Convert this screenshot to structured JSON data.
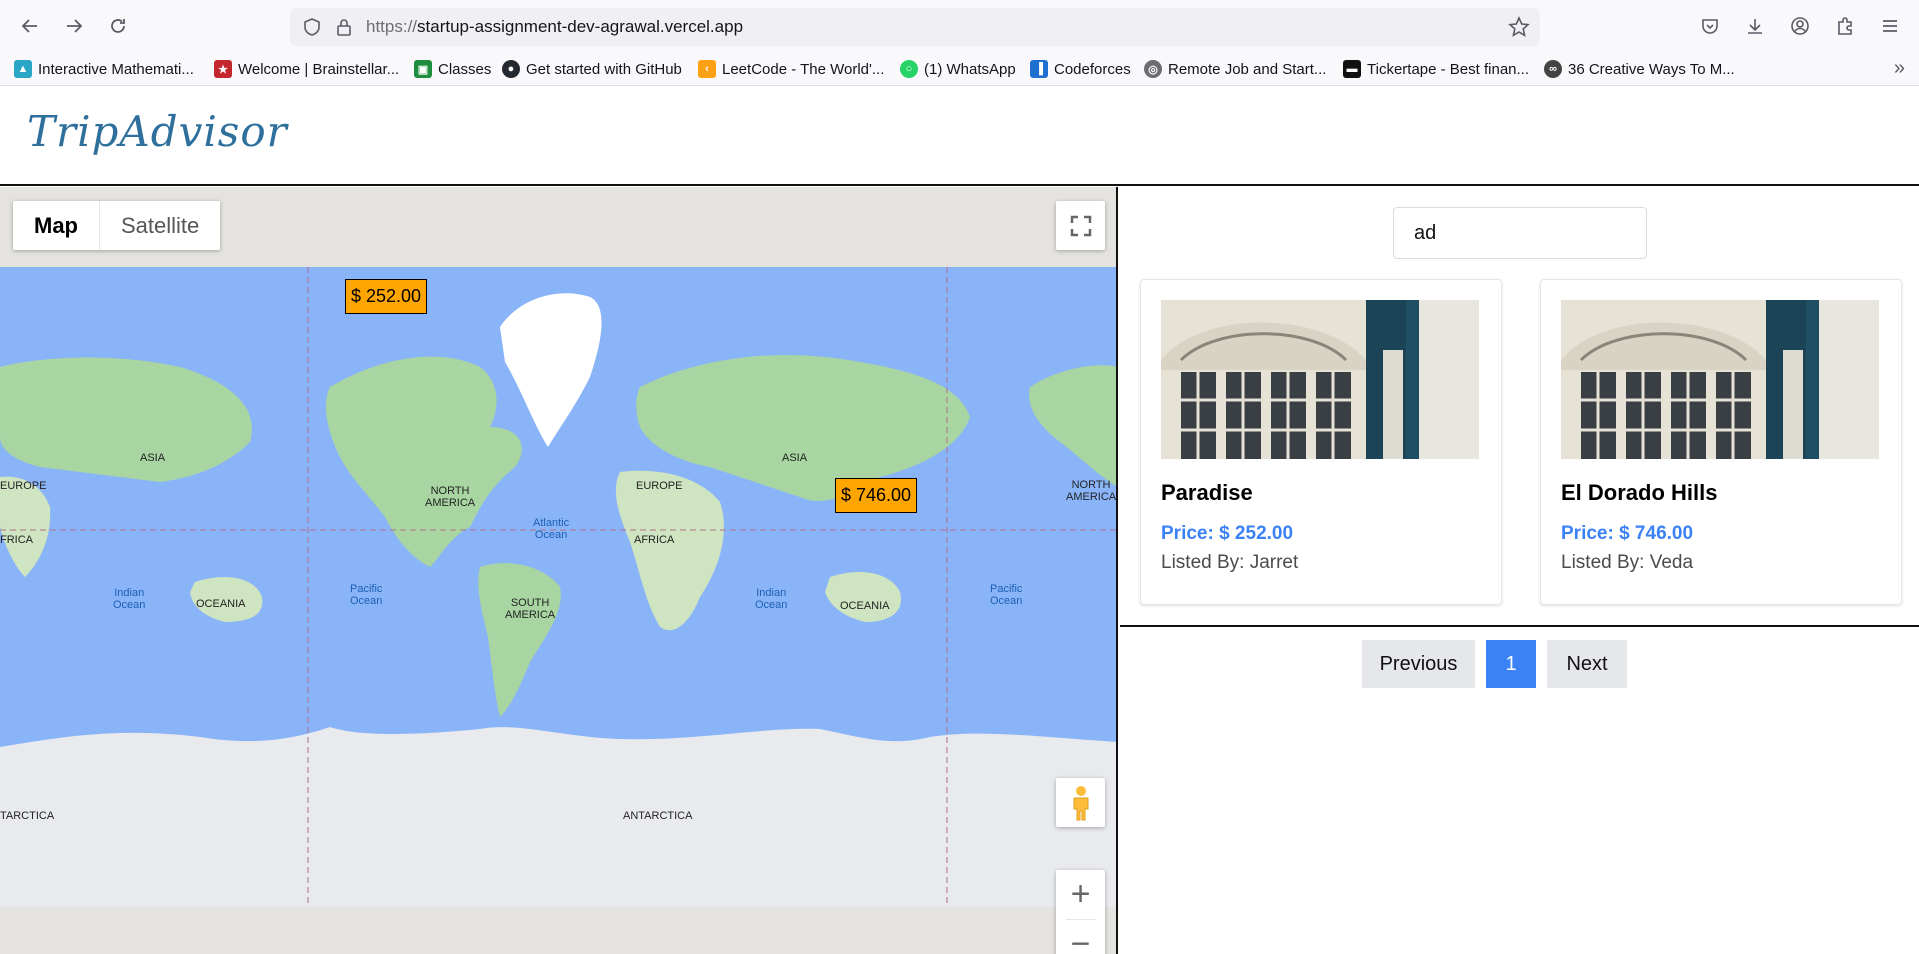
{
  "browser": {
    "url_protocol": "https://",
    "url_host": "startup-assignment-dev-agrawal.vercel.app",
    "bookmarks": [
      {
        "label": "Interactive Mathemati...",
        "color": "#2aa7c7",
        "glyph": "▲"
      },
      {
        "label": "Welcome | Brainstellar...",
        "color": "#c4262e",
        "glyph": "★"
      },
      {
        "label": "Classes",
        "color": "#1e8e3e",
        "glyph": "▣"
      },
      {
        "label": "Get started with GitHub",
        "color": "#24292f",
        "glyph": "●"
      },
      {
        "label": "LeetCode - The World'...",
        "color": "#ffa116",
        "glyph": "‹"
      },
      {
        "label": "(1) WhatsApp",
        "color": "#25d366",
        "glyph": "○"
      },
      {
        "label": "Codeforces",
        "color": "#1f6fd0",
        "glyph": "▐"
      },
      {
        "label": "Remote Job and Start...",
        "color": "#6b6b70",
        "glyph": "◎"
      },
      {
        "label": "Tickertape - Best finan...",
        "color": "#111111",
        "glyph": "▬"
      },
      {
        "label": "36 Creative Ways To M...",
        "color": "#444444",
        "glyph": "∞"
      }
    ]
  },
  "app": {
    "logo": "TripAdvisor"
  },
  "map": {
    "type_map": "Map",
    "type_satellite": "Satellite",
    "markers": [
      "$ 252.00",
      "$ 746.00"
    ],
    "labels": {
      "asia_left": "ASIA",
      "europe_left": "EUROPE",
      "africa_left": "FRICA",
      "indian_ocean_left": "Indian\nOcean",
      "oceania_left": "OCEANIA",
      "antarctica_left": "TARCTICA",
      "pacific_left": "Pacific\nOcean",
      "north_america": "NORTH\nAMERICA",
      "atlantic": "Atlantic\nOcean",
      "south_america": "SOUTH\nAMERICA",
      "antarctica": "ANTARCTICA",
      "europe": "EUROPE",
      "africa": "AFRICA",
      "asia": "ASIA",
      "indian_ocean": "Indian\nOcean",
      "oceania": "OCEANIA",
      "pacific_right": "Pacific\nOcean",
      "north_america_right": "NORTH\nAMERICA"
    }
  },
  "search": {
    "value": "ad"
  },
  "listings": [
    {
      "title": "Paradise",
      "price": "Price: $ 252.00",
      "owner": "Listed By: Jarret"
    },
    {
      "title": "El Dorado Hills",
      "price": "Price: $ 746.00",
      "owner": "Listed By: Veda"
    }
  ],
  "pagination": {
    "previous": "Previous",
    "page": "1",
    "next": "Next"
  }
}
